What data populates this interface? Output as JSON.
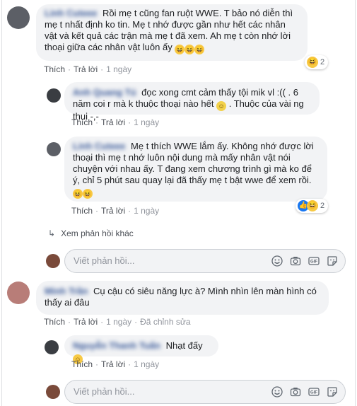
{
  "comments": [
    {
      "author": "Linh Cuteee",
      "text": "Rồi mẹ t cũng fan ruột WWE. T bảo nó diễn thì mẹ t nhất định ko tin. Mẹ t nhớ được gần như hết các nhân vật và kết quả các trận mà mẹ t đã xem. Ah mẹ t còn nhớ lời thoại giữa các nhân vật luôn ấy",
      "emoji_count": 3,
      "like_label": "Thích",
      "reply_label": "Trả lời",
      "time": "1 ngày",
      "reaction_count": "2",
      "replies": [
        {
          "author": "Anh Quang Tú",
          "text_before": "đọc xong cmt cảm thấy tội mik vl :(( . 6 năm coi r mà k thuộc thoại nào hết",
          "text_after": ". Thuộc của vài ng thui -,-",
          "like_label": "Thích",
          "reply_label": "Trả lời",
          "time": "1 ngày"
        },
        {
          "author": "Linh Cuteee",
          "text": "Mẹ t thích WWE lắm ấy. Không nhớ được lời thoại thì mẹ t nhớ luôn nội dung mà mấy nhân vật nói chuyện với nhau ấy. T đang xem chương trình gì mà ko để ý, chỉ 5 phút sau quay lại đã thấy mẹ t bật wwe để xem rồi.",
          "like_label": "Thích",
          "reply_label": "Trả lời",
          "time": "1 ngày",
          "reaction_count": "2"
        }
      ],
      "more_replies": "Xem phản hồi khác",
      "reply_placeholder": "Viết phản hồi..."
    },
    {
      "author": "Minh Trần",
      "text": "Cụ cậu có siêu năng lực à? Mình nhìn lên màn hình có thấy ai đâu",
      "like_label": "Thích",
      "reply_label": "Trả lời",
      "time": "1 ngày",
      "edited_label": "Đã chỉnh sửa",
      "replies": [
        {
          "author": "Nguyễn Thanh Tuấn",
          "text": "Nhạt đấy",
          "like_label": "Thích",
          "reply_label": "Trả lời",
          "time": "1 ngày"
        }
      ],
      "reply_placeholder": "Viết phản hồi..."
    }
  ],
  "icons": {
    "emoji": "smiley-icon",
    "camera": "camera-icon",
    "gif": "gif-icon",
    "sticker": "sticker-icon"
  },
  "colors": {
    "bubble": "#f2f3f5",
    "link": "#385898",
    "meta": "#606770"
  }
}
